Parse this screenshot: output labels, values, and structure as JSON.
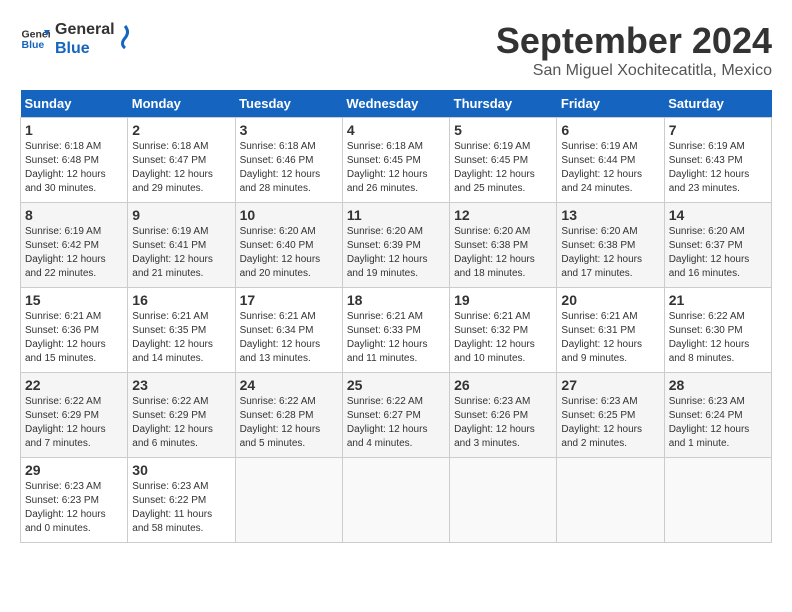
{
  "logo": {
    "line1": "General",
    "line2": "Blue"
  },
  "title": "September 2024",
  "location": "San Miguel Xochitecatitla, Mexico",
  "days_of_week": [
    "Sunday",
    "Monday",
    "Tuesday",
    "Wednesday",
    "Thursday",
    "Friday",
    "Saturday"
  ],
  "weeks": [
    [
      {
        "day": "1",
        "sunrise": "6:18 AM",
        "sunset": "6:48 PM",
        "daylight": "12 hours and 30 minutes."
      },
      {
        "day": "2",
        "sunrise": "6:18 AM",
        "sunset": "6:47 PM",
        "daylight": "12 hours and 29 minutes."
      },
      {
        "day": "3",
        "sunrise": "6:18 AM",
        "sunset": "6:46 PM",
        "daylight": "12 hours and 28 minutes."
      },
      {
        "day": "4",
        "sunrise": "6:18 AM",
        "sunset": "6:45 PM",
        "daylight": "12 hours and 26 minutes."
      },
      {
        "day": "5",
        "sunrise": "6:19 AM",
        "sunset": "6:45 PM",
        "daylight": "12 hours and 25 minutes."
      },
      {
        "day": "6",
        "sunrise": "6:19 AM",
        "sunset": "6:44 PM",
        "daylight": "12 hours and 24 minutes."
      },
      {
        "day": "7",
        "sunrise": "6:19 AM",
        "sunset": "6:43 PM",
        "daylight": "12 hours and 23 minutes."
      }
    ],
    [
      {
        "day": "8",
        "sunrise": "6:19 AM",
        "sunset": "6:42 PM",
        "daylight": "12 hours and 22 minutes."
      },
      {
        "day": "9",
        "sunrise": "6:19 AM",
        "sunset": "6:41 PM",
        "daylight": "12 hours and 21 minutes."
      },
      {
        "day": "10",
        "sunrise": "6:20 AM",
        "sunset": "6:40 PM",
        "daylight": "12 hours and 20 minutes."
      },
      {
        "day": "11",
        "sunrise": "6:20 AM",
        "sunset": "6:39 PM",
        "daylight": "12 hours and 19 minutes."
      },
      {
        "day": "12",
        "sunrise": "6:20 AM",
        "sunset": "6:38 PM",
        "daylight": "12 hours and 18 minutes."
      },
      {
        "day": "13",
        "sunrise": "6:20 AM",
        "sunset": "6:38 PM",
        "daylight": "12 hours and 17 minutes."
      },
      {
        "day": "14",
        "sunrise": "6:20 AM",
        "sunset": "6:37 PM",
        "daylight": "12 hours and 16 minutes."
      }
    ],
    [
      {
        "day": "15",
        "sunrise": "6:21 AM",
        "sunset": "6:36 PM",
        "daylight": "12 hours and 15 minutes."
      },
      {
        "day": "16",
        "sunrise": "6:21 AM",
        "sunset": "6:35 PM",
        "daylight": "12 hours and 14 minutes."
      },
      {
        "day": "17",
        "sunrise": "6:21 AM",
        "sunset": "6:34 PM",
        "daylight": "12 hours and 13 minutes."
      },
      {
        "day": "18",
        "sunrise": "6:21 AM",
        "sunset": "6:33 PM",
        "daylight": "12 hours and 11 minutes."
      },
      {
        "day": "19",
        "sunrise": "6:21 AM",
        "sunset": "6:32 PM",
        "daylight": "12 hours and 10 minutes."
      },
      {
        "day": "20",
        "sunrise": "6:21 AM",
        "sunset": "6:31 PM",
        "daylight": "12 hours and 9 minutes."
      },
      {
        "day": "21",
        "sunrise": "6:22 AM",
        "sunset": "6:30 PM",
        "daylight": "12 hours and 8 minutes."
      }
    ],
    [
      {
        "day": "22",
        "sunrise": "6:22 AM",
        "sunset": "6:29 PM",
        "daylight": "12 hours and 7 minutes."
      },
      {
        "day": "23",
        "sunrise": "6:22 AM",
        "sunset": "6:29 PM",
        "daylight": "12 hours and 6 minutes."
      },
      {
        "day": "24",
        "sunrise": "6:22 AM",
        "sunset": "6:28 PM",
        "daylight": "12 hours and 5 minutes."
      },
      {
        "day": "25",
        "sunrise": "6:22 AM",
        "sunset": "6:27 PM",
        "daylight": "12 hours and 4 minutes."
      },
      {
        "day": "26",
        "sunrise": "6:23 AM",
        "sunset": "6:26 PM",
        "daylight": "12 hours and 3 minutes."
      },
      {
        "day": "27",
        "sunrise": "6:23 AM",
        "sunset": "6:25 PM",
        "daylight": "12 hours and 2 minutes."
      },
      {
        "day": "28",
        "sunrise": "6:23 AM",
        "sunset": "6:24 PM",
        "daylight": "12 hours and 1 minute."
      }
    ],
    [
      {
        "day": "29",
        "sunrise": "6:23 AM",
        "sunset": "6:23 PM",
        "daylight": "12 hours and 0 minutes."
      },
      {
        "day": "30",
        "sunrise": "6:23 AM",
        "sunset": "6:22 PM",
        "daylight": "11 hours and 58 minutes."
      },
      null,
      null,
      null,
      null,
      null
    ]
  ]
}
